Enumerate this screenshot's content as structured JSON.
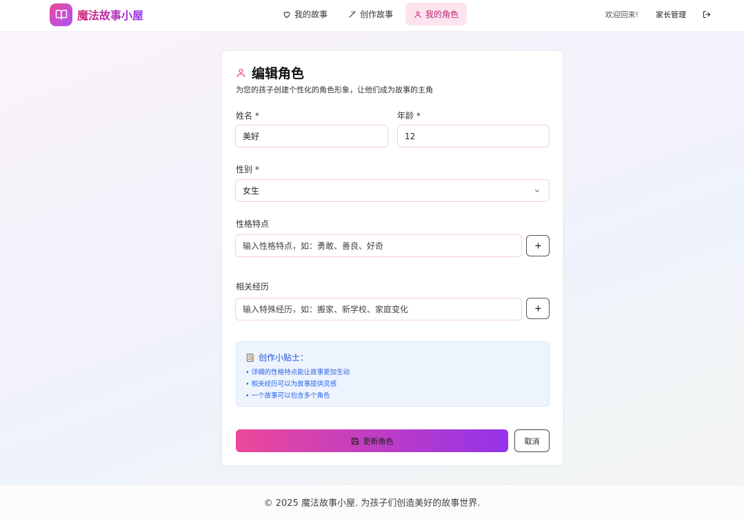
{
  "app": {
    "logo_text": "魔法故事小屋",
    "brand_gradient": [
      "#ec4899",
      "#a855f7"
    ]
  },
  "nav": {
    "items": [
      {
        "label": "我的故事",
        "icon": "heart-icon",
        "active": false
      },
      {
        "label": "创作故事",
        "icon": "magic-wand-icon",
        "active": false
      },
      {
        "label": "我的角色",
        "icon": "user-icon",
        "active": true
      }
    ]
  },
  "header": {
    "welcome": "欢迎回来!",
    "parent_admin": "家长管理",
    "logout_icon": "logout-icon"
  },
  "form": {
    "title": "编辑角色",
    "subtitle": "为您的孩子创建个性化的角色形象，让他们成为故事的主角",
    "name_label": "姓名 *",
    "name_value": "美好",
    "age_label": "年龄 *",
    "age_value": "12",
    "gender_label": "性别 *",
    "gender_value": "女生",
    "traits_label": "性格特点",
    "traits_placeholder": "输入性格特点，如：勇敢、善良、好奇",
    "experience_label": "相关经历",
    "experience_placeholder": "输入特殊经历，如：搬家、新学校、家庭变化",
    "submit_label": "更新角色",
    "cancel_label": "取消"
  },
  "tips": {
    "title": "创作小贴士：",
    "items": [
      "• 详细的性格特点能让故事更加生动",
      "• 相关经历可以为故事提供灵感",
      "• 一个故事可以包含多个角色"
    ]
  },
  "footer": {
    "text": "© 2025 魔法故事小屋. 为孩子们创造美好的故事世界."
  },
  "colors": {
    "accent_pink": "#ec4899",
    "accent_purple": "#9333ea",
    "active_nav_bg": "#fce4ef",
    "tips_bg": "#eef4fd",
    "tips_text": "#2563eb"
  }
}
